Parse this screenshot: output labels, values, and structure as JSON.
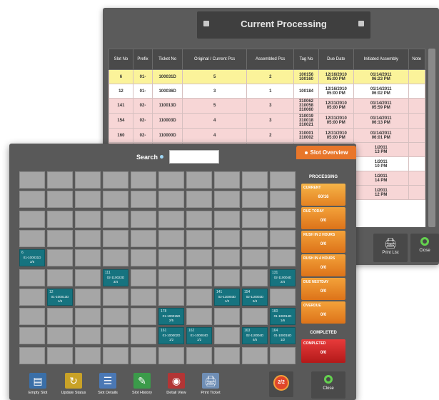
{
  "back_window": {
    "title": "Current Processing",
    "columns": [
      "Slot No",
      "Prefix",
      "Ticket No",
      "Original / Current Pcs",
      "Assembled Pcs",
      "Tag No",
      "Due Date",
      "Initiated Assembly",
      "Note"
    ],
    "rows": [
      {
        "slot": "6",
        "prefix": "01-",
        "ticket": "100031D",
        "pcs": "5",
        "assembled": "2",
        "tag": "100156\n100160",
        "due": "12/16/2010\n05:00 PM",
        "initiated": "01/14/2011\n06:23 PM",
        "note": "",
        "style": "yellow"
      },
      {
        "slot": "12",
        "prefix": "01-",
        "ticket": "100036D",
        "pcs": "3",
        "assembled": "1",
        "tag": "100184",
        "due": "12/16/2010\n05:00 PM",
        "initiated": "01/14/2011\n06:02 PM",
        "note": "",
        "style": "white"
      },
      {
        "slot": "141",
        "prefix": "02-",
        "ticket": "110013D",
        "pcs": "5",
        "assembled": "3",
        "tag": "310062\n310058\n310060",
        "due": "12/31/2010\n05:00 PM",
        "initiated": "01/14/2011\n05:59 PM",
        "note": "",
        "style": "pink"
      },
      {
        "slot": "154",
        "prefix": "02-",
        "ticket": "110003D",
        "pcs": "4",
        "assembled": "3",
        "tag": "310019\n310018\n310021",
        "due": "12/31/2010\n05:00 PM",
        "initiated": "01/14/2011\n06:13 PM",
        "note": "",
        "style": "pink"
      },
      {
        "slot": "160",
        "prefix": "02-",
        "ticket": "110000D",
        "pcs": "4",
        "assembled": "2",
        "tag": "310001\n310002",
        "due": "12/31/2010\n05:00 PM",
        "initiated": "01/14/2011\n06:01 PM",
        "note": "",
        "style": "pink"
      }
    ],
    "partial_rows": [
      {
        "initiated": "1/2011\n13 PM",
        "style": "pink"
      },
      {
        "initiated": "1/2011\n10 PM",
        "style": "white"
      },
      {
        "initiated": "1/2011\n14 PM",
        "style": "pink"
      },
      {
        "initiated": "1/2011\n12 PM",
        "style": "pink"
      }
    ],
    "buttons": {
      "print_list": "Print List",
      "close": "Close"
    }
  },
  "front_window": {
    "search_label": "Search",
    "search_value": "",
    "tab_label": "Slot Overview",
    "slots": [
      {
        "id": "A1",
        "num": "6",
        "prefix": "01-100031D",
        "count": "3/5"
      },
      {
        "id": "B1",
        "num": "111",
        "prefix": "02-110022D",
        "count": "3/4"
      },
      {
        "id": "C1",
        "num": "131",
        "prefix": "02-110004D",
        "count": "2/4"
      },
      {
        "id": "D1",
        "num": "12",
        "prefix": "01-100013D",
        "count": "1/6"
      },
      {
        "id": "D2",
        "num": "141",
        "prefix": "02-110003D",
        "count": "1/2"
      },
      {
        "id": "D3",
        "num": "154",
        "prefix": "02-110002D",
        "count": "2/4"
      },
      {
        "id": "E1",
        "num": "178",
        "prefix": "01-100015D",
        "count": "2/5"
      },
      {
        "id": "E2",
        "num": "160",
        "prefix": "01-100014D",
        "count": "1/6"
      },
      {
        "id": "F1",
        "num": "161",
        "prefix": "01-100002D",
        "count": "1/2"
      },
      {
        "id": "F2",
        "num": "162",
        "prefix": "01-100004D",
        "count": "1/2"
      },
      {
        "id": "F3",
        "num": "163",
        "prefix": "02-110004D",
        "count": "4/5"
      },
      {
        "id": "F4",
        "num": "164",
        "prefix": "01-100015D",
        "count": "1/2"
      }
    ],
    "status": {
      "processing_header": "PROCESSING",
      "current_label": "CURRENT",
      "current_value": "60/16",
      "due_today_label": "DUE TODAY",
      "due_today_value": "0/0",
      "rush2_label": "RUSH IN 2 HOURS",
      "rush2_value": "0/0",
      "rush4_label": "RUSH IN 4 HOURS",
      "rush4_value": "0/0",
      "due_nextday_label": "DUE NEXTDAY",
      "due_nextday_value": "0/0",
      "overdue_label": "OVERDUE",
      "overdue_value": "0/0",
      "completed_header": "COMPLETED",
      "completed_label": "COMPLETED",
      "completed_value": "0/0"
    },
    "toolbar": {
      "empty_slot": "Empty Slot",
      "update_status": "Update Status",
      "slot_details": "Slot Details",
      "slot_history": "Slot History",
      "detail_view": "Detail View",
      "print_ticket": "Print Ticket",
      "counter": "2/2",
      "close": "Close"
    }
  }
}
